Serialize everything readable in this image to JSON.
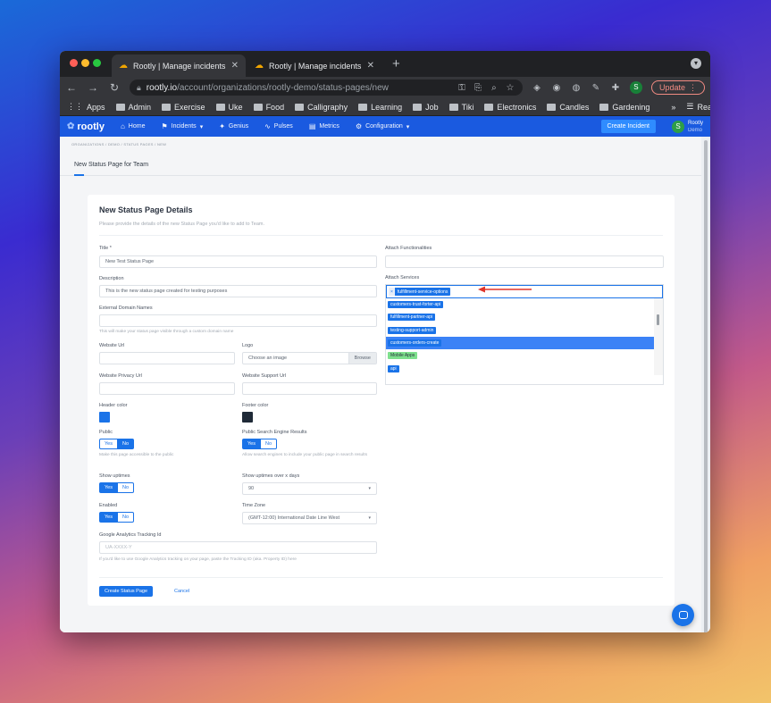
{
  "browser": {
    "tabs": [
      {
        "title": "Rootly | Manage incidents dire",
        "active": true
      },
      {
        "title": "Rootly | Manage incidents dire",
        "active": false
      }
    ],
    "url_host": "rootly.io",
    "url_path": "/account/organizations/rootly-demo/status-pages/new",
    "update_label": "Update",
    "profile_initial": "S",
    "bookmarks": [
      "Apps",
      "Admin",
      "Exercise",
      "Uke",
      "Food",
      "Calligraphy",
      "Learning",
      "Job",
      "Tiki",
      "Electronics",
      "Candles",
      "Gardening"
    ],
    "overflow": "»",
    "reading_list": "Reading List"
  },
  "app": {
    "logo": "rootly",
    "nav": [
      {
        "label": "Home",
        "icon": "home-icon",
        "glyph": "⌂"
      },
      {
        "label": "Incidents",
        "icon": "incidents-icon",
        "glyph": "⚑",
        "dropdown": true
      },
      {
        "label": "Genius",
        "icon": "genius-icon",
        "glyph": "✦"
      },
      {
        "label": "Pulses",
        "icon": "pulses-icon",
        "glyph": "∿"
      },
      {
        "label": "Metrics",
        "icon": "metrics-icon",
        "glyph": "▤"
      },
      {
        "label": "Configuration",
        "icon": "configuration-icon",
        "glyph": "⚙",
        "dropdown": true
      }
    ],
    "create_incident": "Create Incident",
    "user": {
      "initial": "S",
      "name": "Rootly",
      "sub": "Demo"
    }
  },
  "breadcrumb": "ORGANIZATIONS  /  DEMO  /  STATUS PAGES  /  NEW",
  "page_tab": "New Status Page for Team",
  "form": {
    "title": "New Status Page Details",
    "subtitle": "Please provide the details of the new Status Page you'd like to add to Team.",
    "title_label": "Title *",
    "title_value": "New Test Status Page",
    "description_label": "Description",
    "description_value": "This is the new status page created for testing purposes",
    "external_domain_label": "External Domain Names",
    "external_domain_hint": "This will make your status page visible through a custom domain name",
    "website_url_label": "Website Url",
    "logo_label": "Logo",
    "logo_placeholder": "Choose an image",
    "browse": "Browse",
    "privacy_url_label": "Website Privacy Url",
    "support_url_label": "Website Support Url",
    "header_color_label": "Header color",
    "header_color": "#1a73e8",
    "footer_color_label": "Footer color",
    "footer_color": "#1f2a37",
    "public_label": "Public",
    "public_hint": "Make this page accessible to the public",
    "search_label": "Public Search Engine Results",
    "search_hint": "Allow search engines to include your public page in search results",
    "show_uptimes_label": "Show uptimes",
    "uptime_days_label": "Show uptimes over x days",
    "uptime_days_value": "90",
    "enabled_label": "Enabled",
    "timezone_label": "Time Zone",
    "timezone_value": "(GMT-12:00) International Date Line West",
    "ga_label": "Google Analytics Tracking Id",
    "ga_placeholder": "UA-XXXX-Y",
    "ga_hint": "If you'd like to use Google Analytics tracking on your page, paste the Tracking ID (aka. Property ID) here",
    "yes": "Yes",
    "no": "No",
    "public": "No",
    "search_engine": "Yes",
    "show_uptimes": "Yes",
    "enabled": "Yes",
    "attach_functionalities_label": "Attach Functionalities",
    "attach_services_label": "Attach Services",
    "selected_service": "fulfillment-service-options",
    "service_options": [
      {
        "label": "customers-trust-forter-api",
        "highlighted": false,
        "group": false
      },
      {
        "label": "fulfillment-partner-api",
        "highlighted": false,
        "group": false
      },
      {
        "label": "testing-support-admin",
        "highlighted": false,
        "group": false
      },
      {
        "label": "customers-orders-create",
        "highlighted": true,
        "group": false
      },
      {
        "label": "Mobile Apps",
        "highlighted": false,
        "group": true
      },
      {
        "label": "api",
        "highlighted": false,
        "group": false
      }
    ],
    "create_button": "Create Status Page",
    "cancel_button": "Cancel"
  },
  "annotation_color": "#e0352b"
}
